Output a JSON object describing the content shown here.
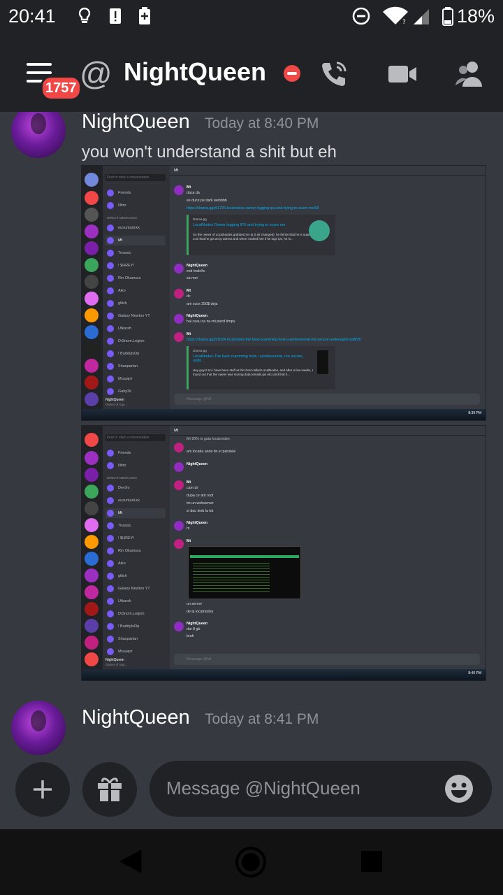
{
  "status_bar": {
    "time": "20:41",
    "battery_percent": "18%",
    "icons": [
      "lightbulb-icon",
      "alert-icon",
      "battery-saver-icon",
      "dnd-icon",
      "wifi-icon",
      "signal-icon",
      "battery-icon"
    ]
  },
  "header": {
    "unread_badge": "1757",
    "at_symbol": "@",
    "channel_name": "NightQueen",
    "status": "do-not-disturb",
    "icons": [
      "call-icon",
      "video-icon",
      "members-icon"
    ]
  },
  "messages": [
    {
      "author": "NightQueen",
      "timestamp": "Today at 8:40 PM",
      "text": "you won't understand a shit but eh",
      "attachments": [
        {
          "dm_header": "Mt",
          "search_placeholder": "Find or start a conversation",
          "nav": [
            "Friends",
            "Nitro",
            "DIRECT MESSAGES"
          ],
          "dm_list": [
            "eusuntadi.kx",
            "Mt",
            "Triassic",
            "! $HREY!",
            "Rin Okumura",
            "Aiko",
            "glitch",
            "Galaxy Newton YT",
            "Utkarsh",
            "Dr3nom.Legion",
            "! BuddyIsOp",
            "Shaxpartan",
            "Мошарт",
            "Gaby2k"
          ],
          "selected_dm": "Mt",
          "lines": [
            {
              "author": "Mt",
              "time": "Today at 19:31",
              "text": "daca da"
            },
            {
              "author": "",
              "time": "",
              "text": "se duce pe dark webbbb"
            },
            {
              "author": "",
              "time": "",
              "text": "https://drama.gg/d/1726-localnodes-owner-logging-ips-and-trying-to-scare-me/68",
              "link": true
            },
            {
              "author": "NightQueen",
              "time": "Today at 19:32",
              "text": "esti malefic"
            },
            {
              "author": "",
              "time": "",
              "text": "sa mor"
            },
            {
              "author": "Mt",
              "time": "Today at 19:32",
              "text": "dc"
            },
            {
              "author": "",
              "time": "",
              "text": "am scos 250$ deja"
            },
            {
              "author": "NightQueen",
              "time": "Today at 19:32",
              "text": "hai ceau ca nu-mi pierd timpu"
            },
            {
              "author": "Mt",
              "time": "Today at 19:33",
              "text": "https://drama.gg/d/1634-localnodes-the-best-scamming-host-u-professional-not-secure-underaged-staff/36",
              "link": true
            }
          ],
          "embeds": [
            {
              "site": "Drama.gg",
              "title": "LocalNodes Owner logging IPS and trying to scare me",
              "body": "So the owner of LocalNodes grabbed my ip (I alr changed), he thinks that he is super cool that he got an ip adress and when I asked him if he logs ips, he lo..."
            },
            {
              "site": "Drama.gg",
              "title": "LocalNodes-The best scamming host, u professional, not secure, unde...",
              "body": "Hey guys! So i have been staff at this host called LocalNodes, and after a few weeks, I found out that the owner was storing data (emails,ips etc) and that h..."
            }
          ],
          "composer_placeholder": "Message @Mt",
          "user_panel": {
            "name": "NightQueen",
            "status": "Owner of Aqu..."
          },
          "clock": "8:39 PM"
        },
        {
          "dm_header": "Mt",
          "search_placeholder": "Find or start a conversation",
          "nav": [
            "Friends",
            "Nitro",
            "DIRECT MESSAGES"
          ],
          "dm_list": [
            "DevXo",
            "eusuntadi.kx",
            "Mt",
            "Triassic",
            "! $HREY!",
            "Rin Okumura",
            "Aiko",
            "glitch",
            "Galaxy Newton YT",
            "Utkarsh",
            "Dr3nom.Legion",
            "! BuddyIsOp",
            "Shaxpartan",
            "Мошарт"
          ],
          "selected_dm": "Mt",
          "lines": [
            {
              "author": "",
              "time": "",
              "text": "Mt 90% is gata localnodes"
            },
            {
              "author": "",
              "time": "",
              "text": "am locatia unde tin ei parolele"
            },
            {
              "author": "NightQueen",
              "time": "Today at 19:40",
              "text": ""
            },
            {
              "author": "Mt",
              "time": "Today at 19:40",
              "text": "cam izi"
            },
            {
              "author": "",
              "time": "",
              "text": "dupa ce am root"
            },
            {
              "author": "",
              "time": "",
              "text": "tin un webserver"
            },
            {
              "author": "",
              "time": "",
              "text": "si dau leak la tot"
            },
            {
              "author": "NightQueen",
              "time": "Today at 19:50",
              "text": "m"
            },
            {
              "author": "Mt",
              "time": "Today at 19:50",
              "text": ""
            },
            {
              "author": "",
              "time": "",
              "text": "un server"
            },
            {
              "author": "",
              "time": "",
              "text": "de la localnodes"
            },
            {
              "author": "NightQueen",
              "time": "Today at 19:50",
              "text": "dar 8 gb"
            },
            {
              "author": "",
              "time": "",
              "text": "bruh"
            }
          ],
          "composer_placeholder": "Message @Mt",
          "user_panel": {
            "name": "NightQueen",
            "status": "Owner of Aqu..."
          },
          "clock": "8:40 PM"
        }
      ]
    },
    {
      "author": "NightQueen",
      "timestamp": "Today at 8:41 PM",
      "text": ""
    }
  ],
  "composer": {
    "placeholder": "Message @NightQueen",
    "icons": [
      "plus-icon",
      "gift-icon",
      "emoji-icon"
    ]
  },
  "nav_bar": {
    "icons": [
      "back-icon",
      "home-icon",
      "recents-icon"
    ]
  },
  "colors": {
    "background": "#36393f",
    "header": "#202225",
    "dnd": "#f04747",
    "link": "#00aff4",
    "embed_bar": "#3ba55c"
  }
}
